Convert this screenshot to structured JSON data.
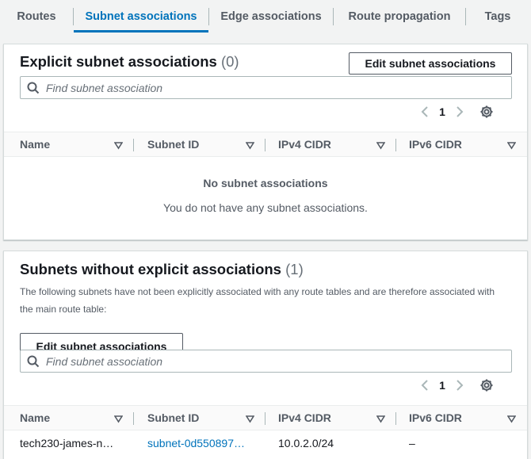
{
  "tabs": [
    {
      "label": "Routes"
    },
    {
      "label": "Subnet associations"
    },
    {
      "label": "Edge associations"
    },
    {
      "label": "Route propagation"
    },
    {
      "label": "Tags"
    }
  ],
  "explicit": {
    "title": "Explicit subnet associations",
    "count": "(0)",
    "edit_button": "Edit subnet associations",
    "search_placeholder": "Find subnet association",
    "page": "1",
    "columns": [
      "Name",
      "Subnet ID",
      "IPv4 CIDR",
      "IPv6 CIDR"
    ],
    "empty_title": "No subnet associations",
    "empty_text": "You do not have any subnet associations."
  },
  "without": {
    "title": "Subnets without explicit associations",
    "count": "(1)",
    "description": "The following subnets have not been explicitly associated with any route tables and are therefore associated with the main route table:",
    "edit_button": "Edit subnet associations",
    "search_placeholder": "Find subnet association",
    "page": "1",
    "columns": [
      "Name",
      "Subnet ID",
      "IPv4 CIDR",
      "IPv6 CIDR"
    ],
    "rows": [
      {
        "name": "tech230-james-n…",
        "subnet_id": "subnet-0d550897…",
        "ipv4": "10.0.2.0/24",
        "ipv6": "–"
      }
    ]
  },
  "colors": {
    "accent": "#0073bb",
    "text": "#16191f",
    "muted": "#545b64",
    "border": "#aab7b8"
  },
  "icons": [
    "search-icon",
    "chevron-left-icon",
    "chevron-right-icon",
    "gear-icon",
    "sort-caret-icon"
  ]
}
